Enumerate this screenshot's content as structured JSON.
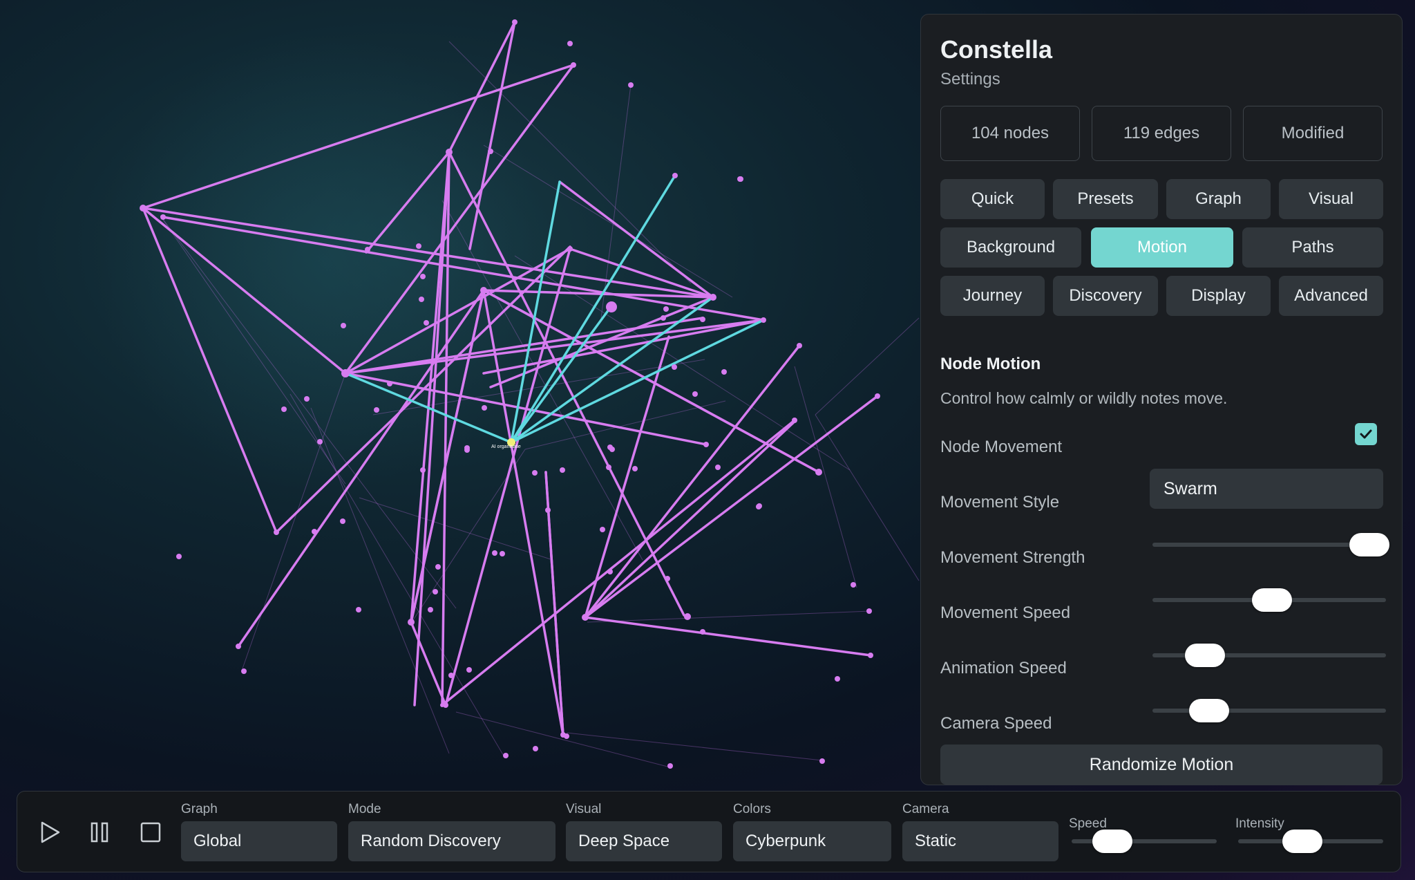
{
  "graph": {
    "center_node_label": "AI organisatie"
  },
  "panel": {
    "title": "Constella",
    "subtitle": "Settings",
    "stats": [
      "104 nodes",
      "119 edges",
      "Modified"
    ],
    "tabs": [
      [
        "Quick",
        "Presets",
        "Graph",
        "Visual"
      ],
      [
        "Background",
        "Motion",
        "Paths"
      ],
      [
        "Journey",
        "Discovery",
        "Display",
        "Advanced"
      ]
    ],
    "active_tab": "Motion",
    "section": {
      "title": "Node Motion",
      "description": "Control how calmly or wildly notes move.",
      "node_movement_label": "Node Movement",
      "node_movement_checked": true,
      "movement_style_label": "Movement Style",
      "movement_style_value": "Swarm",
      "sliders": [
        {
          "label": "Movement Strength",
          "value": 0.97
        },
        {
          "label": "Movement Speed",
          "value": 0.49
        },
        {
          "label": "Animation Speed",
          "value": 0.16
        },
        {
          "label": "Camera Speed",
          "value": 0.18
        }
      ],
      "randomize_label": "Randomize Motion"
    }
  },
  "bottombar": {
    "graph": {
      "label": "Graph",
      "value": "Global"
    },
    "mode": {
      "label": "Mode",
      "value": "Random Discovery"
    },
    "visual": {
      "label": "Visual",
      "value": "Deep Space"
    },
    "colors": {
      "label": "Colors",
      "value": "Cyberpunk"
    },
    "camera": {
      "label": "Camera",
      "value": "Static"
    },
    "speed": {
      "label": "Speed",
      "value": 0.2
    },
    "intensity": {
      "label": "Intensity",
      "value": 0.42
    }
  },
  "colors": {
    "accent": "#74d6d0",
    "edge_primary": "#d77cf0",
    "edge_active": "#5fd9e0",
    "center_node": "#f3f07a"
  }
}
